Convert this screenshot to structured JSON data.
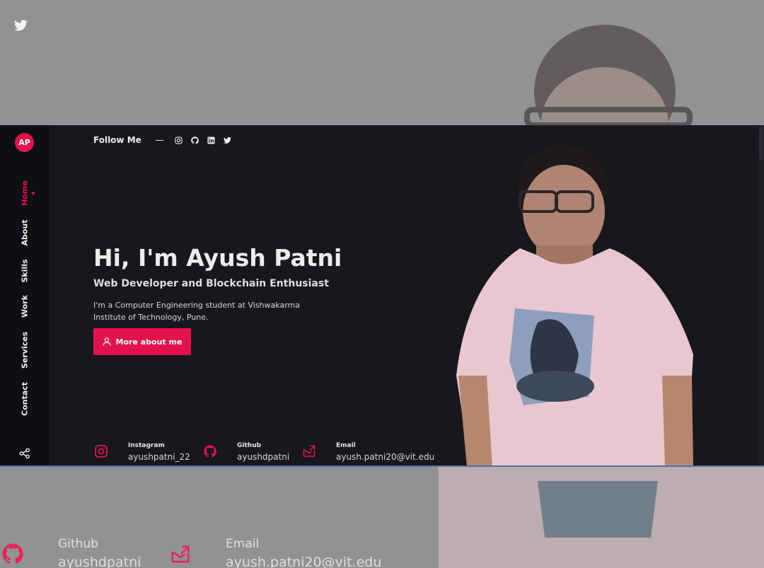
{
  "brand": {
    "logo_initials": "AP"
  },
  "nav": {
    "items": [
      {
        "label": "Home",
        "active": true
      },
      {
        "label": "About"
      },
      {
        "label": "Skills"
      },
      {
        "label": "Work"
      },
      {
        "label": "Services"
      },
      {
        "label": "Contact"
      }
    ]
  },
  "follow": {
    "label": "Follow Me",
    "icons": [
      "instagram-icon",
      "github-icon",
      "linkedin-icon",
      "twitter-icon"
    ]
  },
  "hero": {
    "title": "Hi, I'm Ayush Patni",
    "subtitle": "Web Developer and Blockchain Enthusiast",
    "description": "I'm a Computer Engineering student at Vishwakarma Institute of Technology, Pune.",
    "button_label": "More about me"
  },
  "contacts": [
    {
      "icon": "instagram-icon",
      "label": "Instagram",
      "value": "ayushpatni_22"
    },
    {
      "icon": "github-icon",
      "label": "Github",
      "value": "ayushdpatni"
    },
    {
      "icon": "mail-icon",
      "label": "Email",
      "value": "ayush.patni20@vit.edu"
    }
  ],
  "background": {
    "contacts": [
      {
        "label": "Github",
        "value": "ayushdpatni"
      },
      {
        "label": "Email",
        "value": "ayush.patni20@vit.edu"
      }
    ]
  },
  "colors": {
    "accent": "#e2134c",
    "window_bg": "#17171c",
    "sidebar_bg": "#0f0f13",
    "backdrop": "#929193"
  }
}
